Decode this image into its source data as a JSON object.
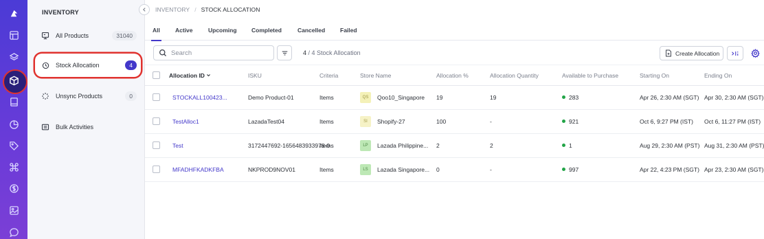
{
  "rail": {
    "icons": [
      "app-logo-icon",
      "layout-icon",
      "layers-icon",
      "box-icon",
      "book-icon",
      "pie-chart-icon",
      "tag-icon",
      "command-icon",
      "dollar-circle-icon",
      "image-icon",
      "chat-icon"
    ],
    "active": "box-icon"
  },
  "sidebar": {
    "title": "INVENTORY",
    "items": [
      {
        "label": "All Products",
        "count": "31040",
        "icon": "monitor-icon"
      },
      {
        "label": "Stock Allocation",
        "count": "4",
        "icon": "clock-icon"
      },
      {
        "label": "Unsync Products",
        "count": "0",
        "icon": "loader-icon"
      },
      {
        "label": "Bulk Activities",
        "count": "",
        "icon": "list-icon"
      }
    ]
  },
  "breadcrumb": {
    "root": "INVENTORY",
    "sep": "/",
    "current": "STOCK ALLOCATION"
  },
  "tabs": [
    "All",
    "Active",
    "Upcoming",
    "Completed",
    "Cancelled",
    "Failed"
  ],
  "toolbar": {
    "search_placeholder": "Search",
    "count_shown": "4",
    "count_sep": " / ",
    "count_total": "4 Stock Allocation",
    "create_label": "Create Allocation"
  },
  "table": {
    "columns": [
      "Allocation ID",
      "ISKU",
      "Criteria",
      "Store Name",
      "Allocation %",
      "Allocation Quantity",
      "Available to Purchase",
      "Starting On",
      "Ending On"
    ],
    "rows": [
      {
        "id": "STOCKALL100423...",
        "isku": "Demo Product-01",
        "criteria": "Items",
        "badge": "QS",
        "badge_color": "#f4f1b8",
        "badge_text": "#9a9442",
        "store": "Qoo10_Singapore",
        "pct": "19",
        "qty": "19",
        "avail": "283",
        "start": "Apr 26, 2:30 AM (SGT)",
        "end": "Apr 30, 2:30 AM (SGT)"
      },
      {
        "id": "TestAlloc1",
        "isku": "LazadaTest04",
        "criteria": "Items",
        "badge": "SI",
        "badge_color": "#f6f2c6",
        "badge_text": "#a39a4a",
        "store": "Shopify-27",
        "pct": "100",
        "qty": "-",
        "avail": "921",
        "start": "Oct 6, 9:27 PM (IST)",
        "end": "Oct 6, 11:27 PM (IST)"
      },
      {
        "id": "Test",
        "isku": "3172447692-1656483933978-0",
        "criteria": "Items",
        "badge": "LP",
        "badge_color": "#bde8b5",
        "badge_text": "#4f8a47",
        "store": "Lazada Philippine...",
        "pct": "2",
        "qty": "2",
        "avail": "1",
        "start": "Aug 29, 2:30 AM (PST)",
        "end": "Aug 31, 2:30 AM (PST)"
      },
      {
        "id": "MFADHFKADKFBA",
        "isku": "NKPROD9NOV01",
        "criteria": "Items",
        "badge": "LS",
        "badge_color": "#bde8b5",
        "badge_text": "#4f8a47",
        "store": "Lazada Singapore...",
        "pct": "0",
        "qty": "-",
        "avail": "997",
        "start": "Apr 22, 4:23 PM (SGT)",
        "end": "Apr 23, 2:30 AM (SGT)"
      }
    ]
  },
  "colors": {
    "accent": "#4338ca",
    "highlight": "#e0322e",
    "available_dot": "#22a447"
  }
}
